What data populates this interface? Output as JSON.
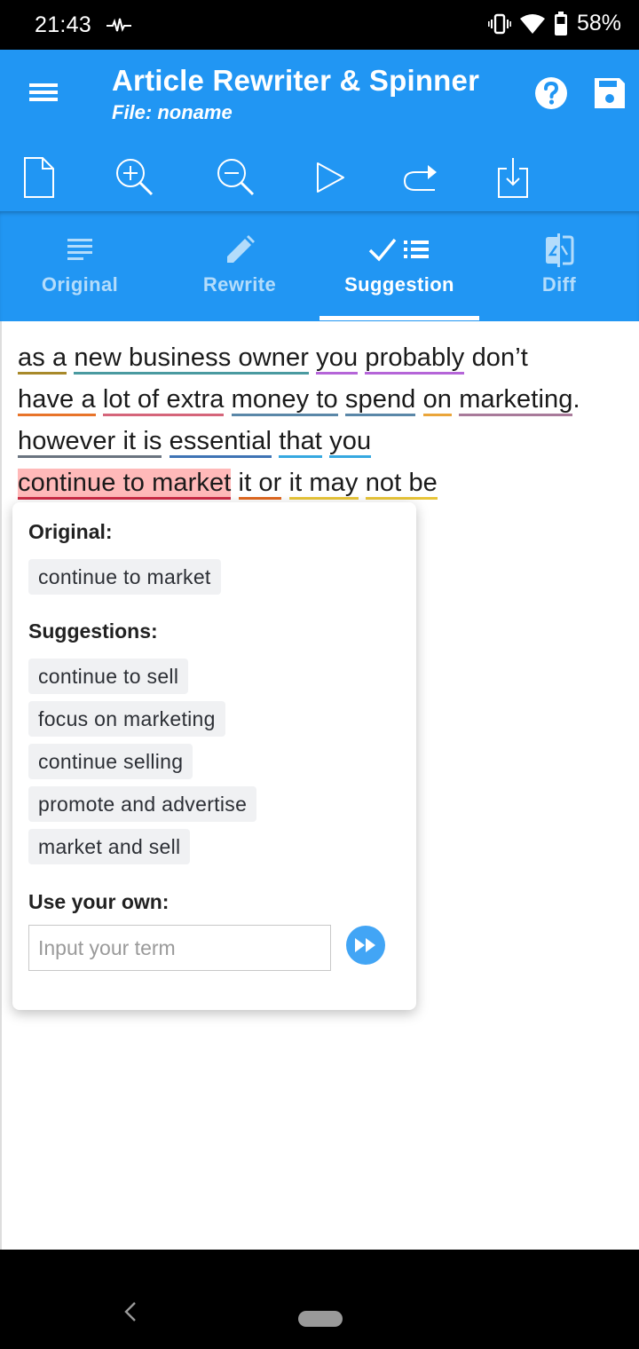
{
  "status_bar": {
    "time": "21:43",
    "battery_percent": "58%",
    "icons": [
      "activity-pulse-icon",
      "vibrate-icon",
      "wifi-icon",
      "battery-icon"
    ]
  },
  "app_bar": {
    "title": "Article Rewriter & Spinner",
    "subtitle": "File: noname",
    "actions": [
      "help-icon",
      "save-icon"
    ],
    "toolbar": [
      "new-file-icon",
      "zoom-in-icon",
      "zoom-out-icon",
      "play-icon",
      "redo-icon",
      "download-icon"
    ]
  },
  "tabs": [
    {
      "label": "Original",
      "icon": "text-lines-icon",
      "active": false
    },
    {
      "label": "Rewrite",
      "icon": "pencil-icon",
      "active": false
    },
    {
      "label": "Suggestion",
      "icon": "check-list-icon",
      "active": true
    },
    {
      "label": "Diff",
      "icon": "diff-icon",
      "active": false
    }
  ],
  "article": {
    "lines": [
      [
        {
          "text": "as a",
          "underline": "#a8892a"
        },
        {
          "text": " "
        },
        {
          "text": "new business owner",
          "underline": "#4a9aa0"
        },
        {
          "text": " "
        },
        {
          "text": "you",
          "underline": "#b565d8"
        },
        {
          "text": " "
        },
        {
          "text": "probably",
          "underline": "#b565d8"
        },
        {
          "text": " don’t"
        }
      ],
      [
        {
          "text": "have a",
          "underline": "#e8742a"
        },
        {
          "text": " "
        },
        {
          "text": "lot of extra",
          "underline": "#d5657a"
        },
        {
          "text": " "
        },
        {
          "text": "money to",
          "underline": "#5a87a8"
        },
        {
          "text": " "
        },
        {
          "text": "spend",
          "underline": "#5a87a8"
        },
        {
          "text": " "
        },
        {
          "text": "on",
          "underline": "#eaa53a"
        },
        {
          "text": " "
        },
        {
          "text": "marketing",
          "underline": "#a87a9a"
        },
        {
          "text": "."
        }
      ],
      [
        {
          "text": "however it is",
          "underline": "#6a7480"
        },
        {
          "text": " "
        },
        {
          "text": "essential",
          "underline": "#3f74b5"
        },
        {
          "text": " "
        },
        {
          "text": "that",
          "underline": "#36a8e0"
        },
        {
          "text": " "
        },
        {
          "text": "you",
          "underline": "#36a8e0"
        }
      ],
      [
        {
          "text": "continue to market",
          "underline": "#cc2a44",
          "highlight": true
        },
        {
          "text": " "
        },
        {
          "text": "it or",
          "underline": "#e06820"
        },
        {
          "text": " "
        },
        {
          "text": "it may",
          "underline": "#e8c53a"
        },
        {
          "text": " "
        },
        {
          "text": "not be",
          "underline": "#e8c53a"
        }
      ]
    ]
  },
  "popup": {
    "original_heading": "Original:",
    "original_phrase": "continue to market",
    "suggestions_heading": "Suggestions:",
    "suggestions": [
      "continue to sell",
      "focus on marketing",
      "continue selling",
      "promote and advertise",
      "market and sell"
    ],
    "own_heading": "Use your own:",
    "own_input_value": "",
    "own_input_placeholder": "Input your term",
    "submit_icon": "fast-forward-icon"
  },
  "nav_bar": {
    "icons": [
      "back-icon",
      "home-pill"
    ]
  },
  "colors": {
    "primary": "#2196f3",
    "tab_inactive": "#b3dcfb",
    "highlight": "#ffb9b9",
    "submit_button": "#42a5f5"
  }
}
